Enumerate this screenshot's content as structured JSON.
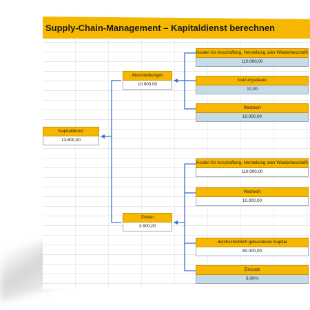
{
  "title": "Supply-Chain-Management – Kapitaldienst berechnen",
  "colors": {
    "accent": "#f5b700",
    "value_blue": "#c6dbe8",
    "connector": "#3a6fd8"
  },
  "root": {
    "label": "Kapitaldienst",
    "value": "13.600,00"
  },
  "abschreibungen": {
    "label": "Abschreibungen",
    "value": "10.000,00",
    "inputs": [
      {
        "label": "Kosten für Anschaffung, Herstellung oder Wiederbeschaffung",
        "value": "110.000,00"
      },
      {
        "label": "Nutzungsdauer",
        "value": "10,00"
      },
      {
        "label": "Restwert",
        "value": "10.000,00"
      }
    ]
  },
  "zinsen": {
    "label": "Zinsen",
    "value": "3.600,00",
    "inputs": [
      {
        "label": "Kosten für Anschaffung, Herstellung oder Wiederbeschaffung",
        "value": "110.000,00"
      },
      {
        "label": "Restwert",
        "value": "10.000,00"
      },
      {
        "label": "durchschnittlich gebundenes Kapital",
        "value": "60.000,00"
      },
      {
        "label": "Zinssatz",
        "value": "6,00%"
      }
    ]
  }
}
